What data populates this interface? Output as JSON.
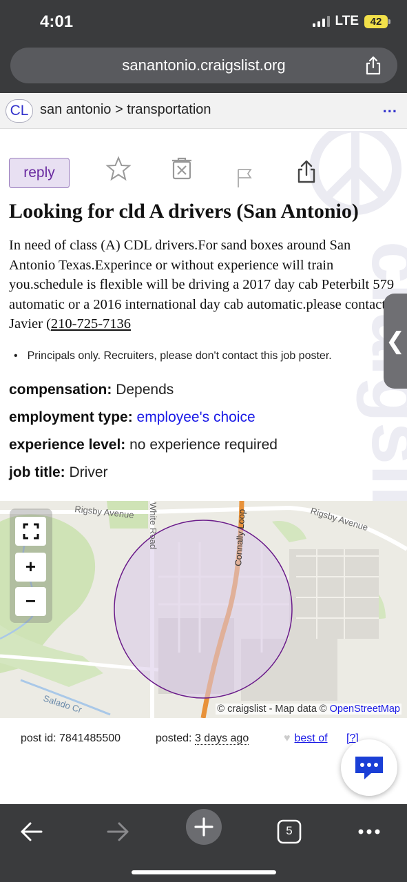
{
  "status": {
    "time": "4:01",
    "network": "LTE",
    "battery": "42"
  },
  "browser": {
    "url": "sanantonio.craigslist.org",
    "tab_count": "5"
  },
  "header": {
    "logo": "CL",
    "breadcrumb": "san antonio > transportation",
    "menu": "..."
  },
  "actions": {
    "reply_label": "reply"
  },
  "posting": {
    "title": "Looking for cld A drivers (San Antonio)",
    "body": "In need of class (A) CDL drivers.For sand boxes around San Antonio Texas.Experince or without experience will train you.schedule is flexible will be driving a 2017 day cab Peterbilt 579 automatic or a 2016 international day cab automatic.please contact Javier (",
    "phone": "210-725-7136",
    "notice": "Principals only. Recruiters, please don't contact this job poster."
  },
  "attributes": [
    {
      "key": "compensation:",
      "value": "Depends"
    },
    {
      "key": "employment type:",
      "value": "employee's choice"
    },
    {
      "key": "experience level:",
      "value": "no experience required"
    },
    {
      "key": "job title:",
      "value": "Driver"
    }
  ],
  "map": {
    "streets": [
      "Rigsby Avenue",
      "Rigsby Avenue",
      "White Road",
      "Connally Loop",
      "Salado Cr"
    ],
    "attribution": "© craigslist - Map data ©",
    "attribution_link": "OpenStreetMap",
    "zoom_in": "+",
    "zoom_out": "−"
  },
  "footer": {
    "post_id": "post id: 7841485500",
    "posted_label": "posted:",
    "posted_value": "3 days ago",
    "best_of": "best of",
    "help": "[?]"
  },
  "colors": {
    "accent": "#6a2ba0",
    "link": "#1a1ae6",
    "chrome": "#3a3b3d",
    "map_circle": "#6a1b8a",
    "road": "#e8923a"
  }
}
